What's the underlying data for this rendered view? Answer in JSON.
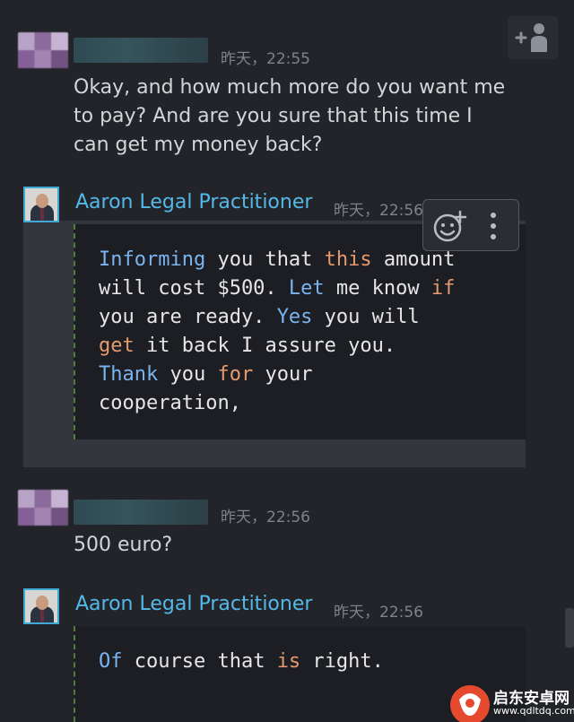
{
  "messages": [
    {
      "timestamp": "昨天，22:55",
      "text_lines": [
        "Okay, and how much more do you want me",
        "to pay? And are you sure that this time I",
        "can get my money back?"
      ]
    },
    {
      "sender": "Aaron Legal Practitioner",
      "timestamp": "昨天，22:56"
    },
    {
      "timestamp": "昨天，22:56",
      "text": "500 euro?"
    },
    {
      "sender": "Aaron Legal Practitioner",
      "timestamp": "昨天，22:56"
    }
  ],
  "code_message_1": {
    "lines": [
      [
        {
          "t": "Informing",
          "c": "blue"
        },
        {
          "t": " you that "
        },
        {
          "t": "this",
          "c": "orange"
        },
        {
          "t": " amount"
        }
      ],
      [
        {
          "t": "will cost $500. "
        },
        {
          "t": "Let",
          "c": "blue"
        },
        {
          "t": " me know "
        },
        {
          "t": "if",
          "c": "orange"
        }
      ],
      [
        {
          "t": "you are ready. "
        },
        {
          "t": "Yes",
          "c": "blue"
        },
        {
          "t": " you will"
        }
      ],
      [
        {
          "t": "get",
          "c": "orange"
        },
        {
          "t": " it back I assure you."
        }
      ],
      [
        {
          "t": "Thank",
          "c": "blue"
        },
        {
          "t": " you "
        },
        {
          "t": "for",
          "c": "orange"
        },
        {
          "t": " your"
        }
      ],
      [
        {
          "t": "cooperation,"
        }
      ]
    ]
  },
  "code_message_2": {
    "lines": [
      [
        {
          "t": "Of",
          "c": "blue"
        },
        {
          "t": " course that "
        },
        {
          "t": "is",
          "c": "orange"
        },
        {
          "t": " right."
        }
      ]
    ]
  },
  "colors": {
    "blue": "#7ab4f0",
    "orange": "#e59a6d",
    "sender": "#53b9e8"
  },
  "icons": {
    "add_friend": "add-friend-icon",
    "reaction": "add-reaction-icon",
    "more": "more-options-icon"
  },
  "watermark": {
    "title": "启东安卓网",
    "url": "www.qdltdq.com"
  }
}
